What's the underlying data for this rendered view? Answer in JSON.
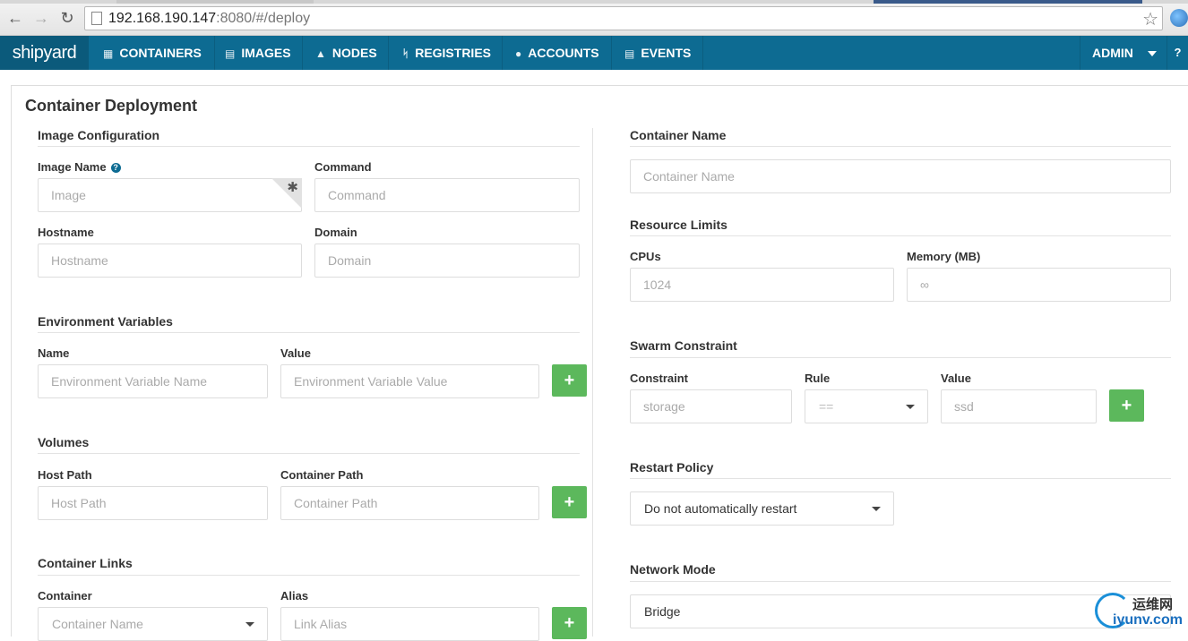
{
  "browser": {
    "url_host": "192.168.190.147",
    "url_rest": ":8080/#/deploy"
  },
  "navbar": {
    "brand": "shipyard",
    "items": [
      {
        "label": "CONTAINERS",
        "icon": "grid-icon"
      },
      {
        "label": "IMAGES",
        "icon": "drive-icon"
      },
      {
        "label": "NODES",
        "icon": "sitemap-icon"
      },
      {
        "label": "REGISTRIES",
        "icon": "fork-icon"
      },
      {
        "label": "ACCOUNTS",
        "icon": "user-icon"
      },
      {
        "label": "EVENTS",
        "icon": "list-icon"
      }
    ],
    "user": "ADMIN",
    "help": "?"
  },
  "page": {
    "title": "Container Deployment"
  },
  "image_config": {
    "title": "Image Configuration",
    "image_name_label": "Image Name",
    "image_placeholder": "Image",
    "command_label": "Command",
    "command_placeholder": "Command",
    "hostname_label": "Hostname",
    "hostname_placeholder": "Hostname",
    "domain_label": "Domain",
    "domain_placeholder": "Domain"
  },
  "env": {
    "title": "Environment Variables",
    "name_label": "Name",
    "name_placeholder": "Environment Variable Name",
    "value_label": "Value",
    "value_placeholder": "Environment Variable Value"
  },
  "volumes": {
    "title": "Volumes",
    "host_label": "Host Path",
    "host_placeholder": "Host Path",
    "container_label": "Container Path",
    "container_placeholder": "Container Path"
  },
  "links": {
    "title": "Container Links",
    "container_label": "Container",
    "container_selected": "Container Name",
    "alias_label": "Alias",
    "alias_placeholder": "Link Alias"
  },
  "container_name": {
    "title": "Container Name",
    "placeholder": "Container Name"
  },
  "resources": {
    "title": "Resource Limits",
    "cpus_label": "CPUs",
    "cpus_placeholder": "1024",
    "memory_label": "Memory (MB)",
    "memory_placeholder": "∞"
  },
  "swarm": {
    "title": "Swarm Constraint",
    "constraint_label": "Constraint",
    "constraint_placeholder": "storage",
    "rule_label": "Rule",
    "rule_selected": "==",
    "value_label": "Value",
    "value_placeholder": "ssd"
  },
  "restart": {
    "title": "Restart Policy",
    "selected": "Do not automatically restart"
  },
  "network": {
    "title": "Network Mode",
    "selected": "Bridge"
  },
  "add_symbol": "+",
  "watermark": {
    "line1": "运维网",
    "line2": "iyunv.com"
  },
  "colors": {
    "navbar": "#0d6b92",
    "brand_bg": "#0b5a7b",
    "add_button": "#5cb85c"
  }
}
